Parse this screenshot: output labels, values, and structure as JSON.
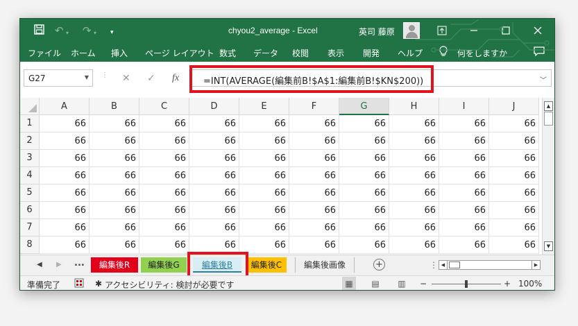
{
  "window": {
    "title": "chyou2_average  -  Excel",
    "user": "英司 藤原",
    "controls": [
      "ribbon-display",
      "minimize",
      "maximize",
      "close"
    ]
  },
  "qat": {
    "save_icon": "save-icon",
    "undo_icon": "undo-icon",
    "redo_icon": "redo-icon",
    "customize": "▾"
  },
  "ribbon": {
    "tabs": [
      "ファイル",
      "ホーム",
      "挿入",
      "ページ レイアウト",
      "数式",
      "データ",
      "校閲",
      "表示",
      "開発",
      "ヘルプ"
    ],
    "tell_me": "何をしますか",
    "comments_icon": "comment-icon"
  },
  "formula_bar": {
    "name_box": "G27",
    "cancel": "✕",
    "enter": "✓",
    "fx": "fx",
    "formula": "=INT(AVERAGE(編集前B!$A$1:編集前B!$KN$200))"
  },
  "grid": {
    "columns": [
      "A",
      "B",
      "C",
      "D",
      "E",
      "F",
      "G",
      "H",
      "I",
      "J"
    ],
    "selected_column": "G",
    "rows": [
      {
        "num": "1",
        "cells": [
          "66",
          "66",
          "66",
          "66",
          "66",
          "66",
          "66",
          "66",
          "66",
          "66"
        ]
      },
      {
        "num": "2",
        "cells": [
          "66",
          "66",
          "66",
          "66",
          "66",
          "66",
          "66",
          "66",
          "66",
          "66"
        ]
      },
      {
        "num": "3",
        "cells": [
          "66",
          "66",
          "66",
          "66",
          "66",
          "66",
          "66",
          "66",
          "66",
          "66"
        ]
      },
      {
        "num": "4",
        "cells": [
          "66",
          "66",
          "66",
          "66",
          "66",
          "66",
          "66",
          "66",
          "66",
          "66"
        ]
      },
      {
        "num": "5",
        "cells": [
          "66",
          "66",
          "66",
          "66",
          "66",
          "66",
          "66",
          "66",
          "66",
          "66"
        ]
      },
      {
        "num": "6",
        "cells": [
          "66",
          "66",
          "66",
          "66",
          "66",
          "66",
          "66",
          "66",
          "66",
          "66"
        ]
      },
      {
        "num": "7",
        "cells": [
          "66",
          "66",
          "66",
          "66",
          "66",
          "66",
          "66",
          "66",
          "66",
          "66"
        ]
      },
      {
        "num": "8",
        "cells": [
          "66",
          "66",
          "66",
          "66",
          "66",
          "66",
          "66",
          "66",
          "66",
          "66"
        ]
      }
    ]
  },
  "sheet_tabs": {
    "overflow": "...",
    "tabs": [
      {
        "label": "編集後R",
        "bg": "#e3001b",
        "color": "#ffffff"
      },
      {
        "label": "編集後G",
        "bg": "#92d050",
        "color": "#1f1f1f"
      },
      {
        "label": "編集後B",
        "bg": "#d9eef3",
        "color": "#2f7fa0",
        "active": true
      },
      {
        "label": "編集後C",
        "bg": "#ffc000",
        "color": "#1f1f1f"
      },
      {
        "label": "編集後画像",
        "bg": "#f0f0f0",
        "color": "#333333"
      }
    ],
    "add_label": "+"
  },
  "status_bar": {
    "ready": "準備完了",
    "accessibility": "アクセシビリティ: 検討が必要です",
    "zoom_minus": "−",
    "zoom_plus": "+",
    "zoom": "100%"
  },
  "colors": {
    "excel_green": "#217346",
    "highlight_red": "#e0141e"
  }
}
